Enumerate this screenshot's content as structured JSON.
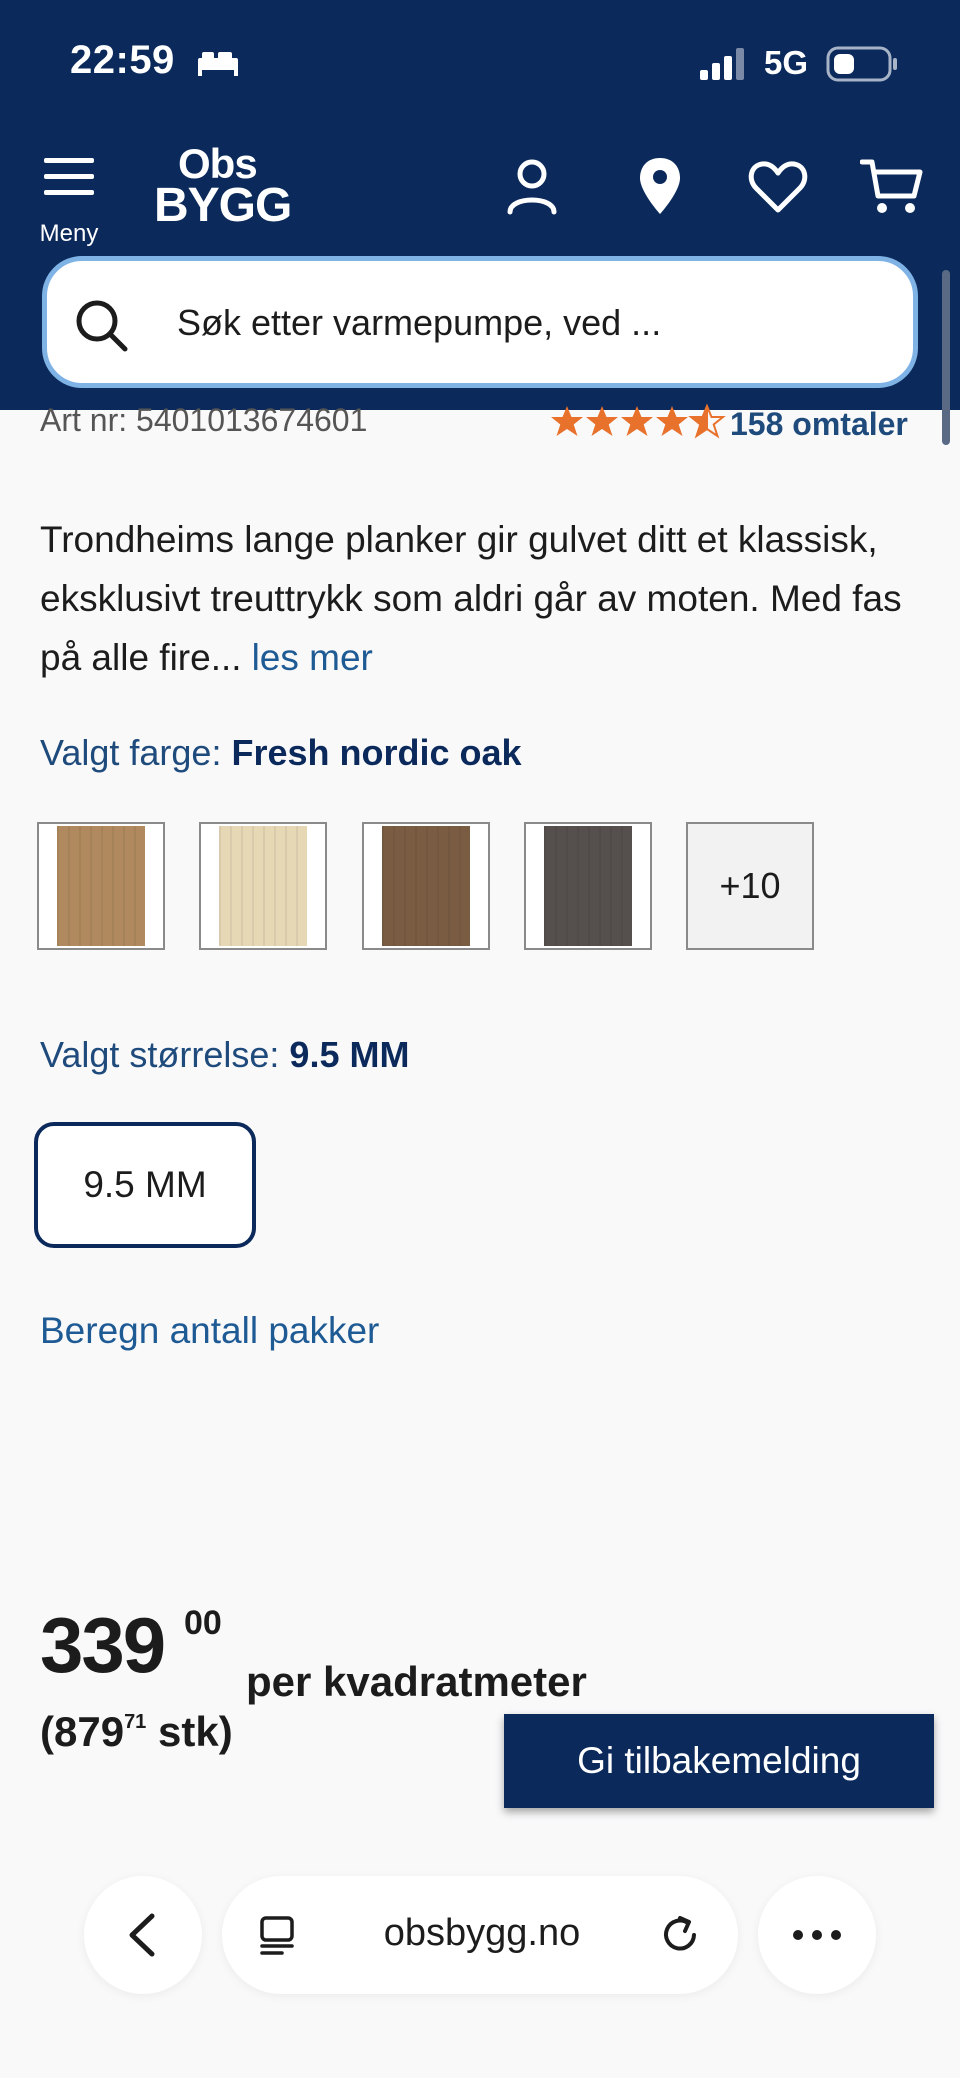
{
  "status": {
    "time": "22:59",
    "network": "5G"
  },
  "header": {
    "menu_label": "Meny",
    "logo_top": "Obs",
    "logo_bottom": "BYGG"
  },
  "search": {
    "placeholder": "Søk etter varmepumpe, ved ..."
  },
  "product": {
    "art_nr": "Art nr: 5401013674601",
    "rating": 4.5,
    "reviews_label": "158 omtaler",
    "description": "Trondheims lange planker gir gulvet ditt et klassisk, eksklusivt treuttrykk som aldri går av moten. Med fas på alle fire...",
    "read_more": "les mer",
    "color_prefix": "Valgt farge:",
    "color_value": "Fresh nordic oak",
    "swatches": [
      {
        "name": "light oak",
        "color": "#b08a5e"
      },
      {
        "name": "fresh nordic oak",
        "color": "#e6d7b5"
      },
      {
        "name": "brown oak",
        "color": "#7a5c42"
      },
      {
        "name": "dark grey oak",
        "color": "#55504d"
      }
    ],
    "more_swatches": "+10",
    "size_prefix": "Valgt størrelse:",
    "size_value": "9.5 MM",
    "size_option": "9.5 MM",
    "calc_link": "Beregn antall pakker"
  },
  "price": {
    "main": "339",
    "cents": "00",
    "unit": "per kvadratmeter",
    "stk_main": "(879",
    "stk_cents": "71",
    "stk_suffix": "stk)"
  },
  "feedback_label": "Gi tilbakemelding",
  "browser": {
    "url": "obsbygg.no"
  },
  "colors": {
    "header_bg": "#0b2a5b",
    "accent_blue": "#1e5a94",
    "star_orange": "#e8722c"
  }
}
